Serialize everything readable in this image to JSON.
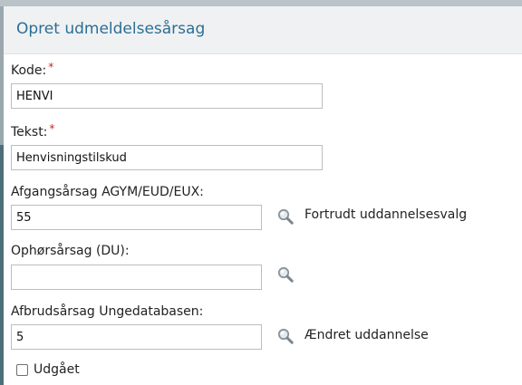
{
  "dialog": {
    "title": "Opret udmeldelsesårsag"
  },
  "form": {
    "kode": {
      "label": "Kode:",
      "required_mark": "*",
      "value": "HENVI"
    },
    "tekst": {
      "label": "Tekst:",
      "required_mark": "*",
      "value": "Henvisningstilskud"
    },
    "afgangsaarsag": {
      "label": "Afgangsårsag AGYM/EUD/EUX:",
      "value": "55",
      "lookup_text": "Fortrudt uddannelsesvalg"
    },
    "ophoersaarsag": {
      "label": "Ophørsårsag (DU):",
      "value": "",
      "lookup_text": ""
    },
    "afbrudsaarsag": {
      "label": "Afbrudsårsag Ungedatabasen:",
      "value": "5",
      "lookup_text": "Ændret uddannelse"
    },
    "udgaaet": {
      "label": "Udgået",
      "checked": false
    }
  },
  "icons": {
    "lookup": "search-icon"
  },
  "colors": {
    "title": "#2a6f96",
    "required": "#d32020",
    "header_bg": "#f0f1f2"
  }
}
